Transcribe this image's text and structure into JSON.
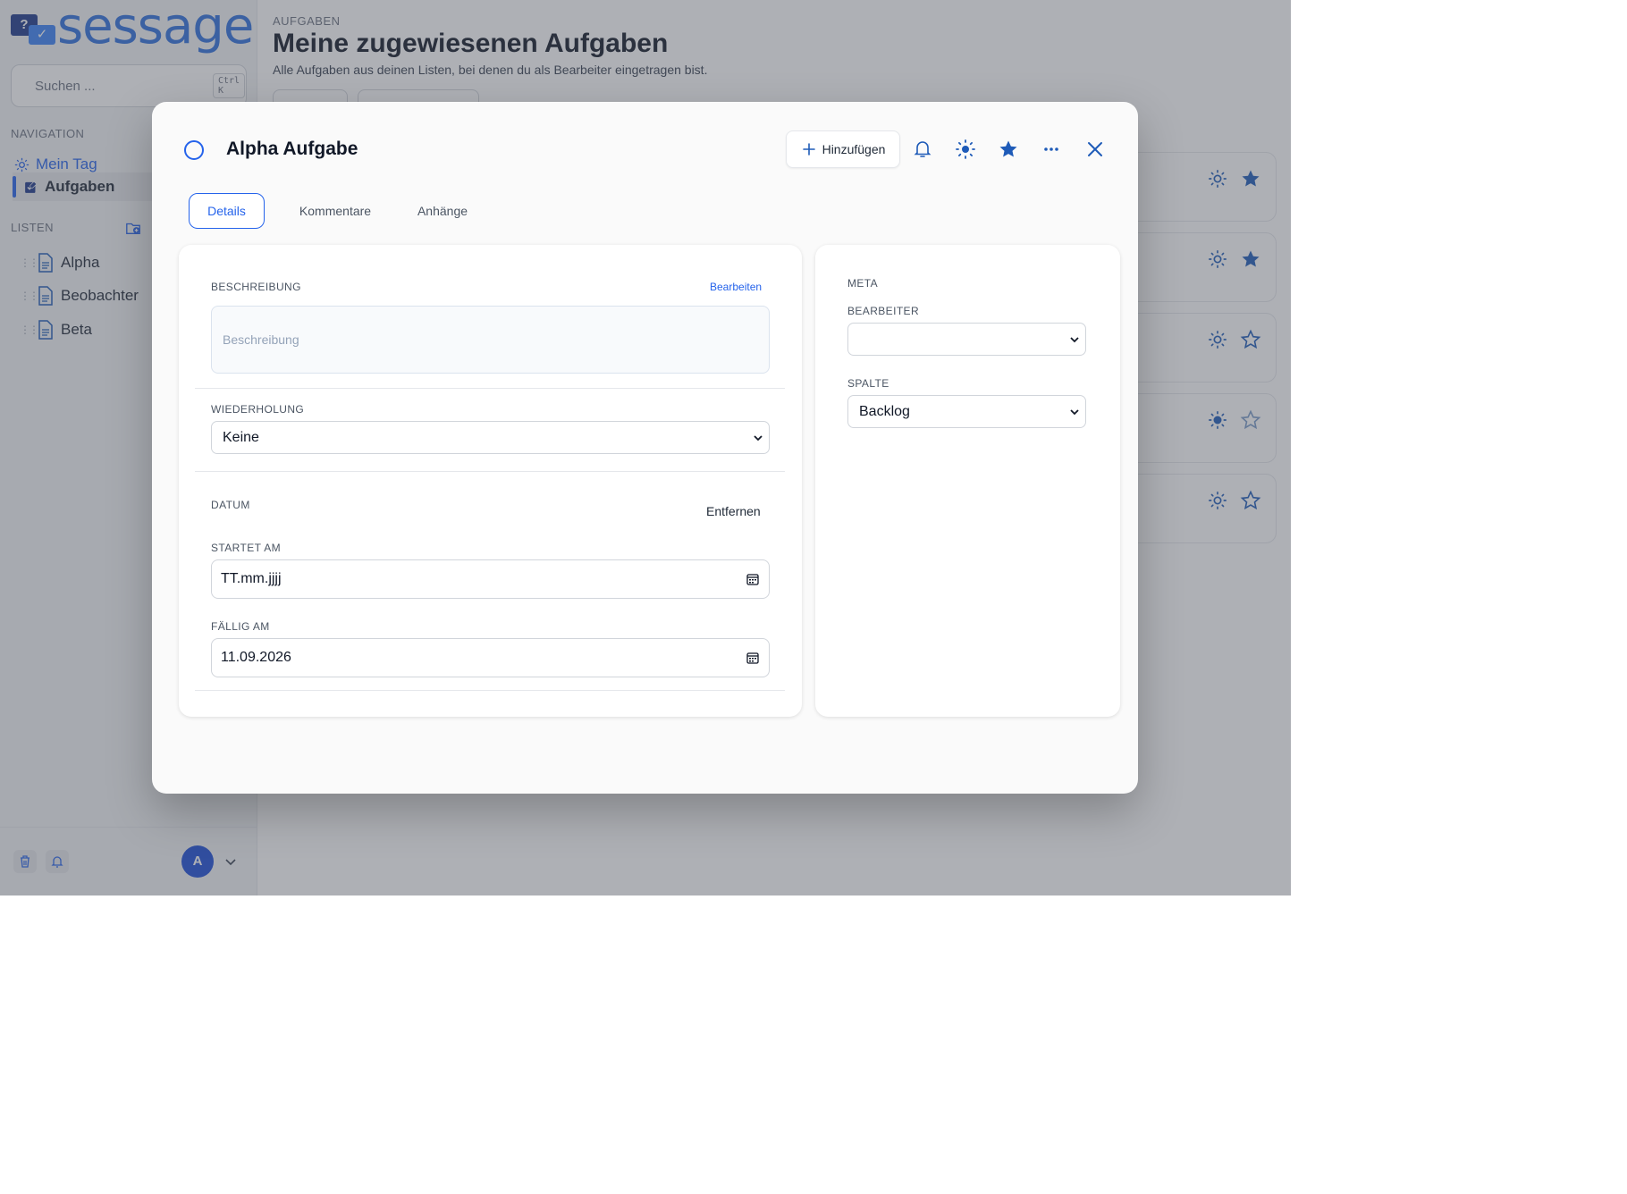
{
  "sidebar": {
    "logo_mark": "?",
    "logo_word": "sessage",
    "search": {
      "placeholder": "Suchen ...",
      "shortcut": "Ctrl K"
    },
    "navigation_label": "NAVIGATION",
    "nav_items": [
      {
        "label": "Mein Tag",
        "icon": "sun-icon"
      },
      {
        "label": "Aufgaben",
        "icon": "tasks-icon",
        "active": true
      }
    ],
    "lists_label": "LISTEN",
    "lists": [
      {
        "label": "Alpha",
        "icon": "document-icon"
      },
      {
        "label": "Beobachter",
        "icon": "document-icon"
      },
      {
        "label": "Beta",
        "icon": "document-icon"
      }
    ],
    "avatar_initial": "A"
  },
  "main": {
    "eyebrow": "AUFGABEN",
    "title": "Meine zugewiesenen Aufgaben",
    "subtitle": "Alle Aufgaben aus deinen Listen, bei denen du als Bearbeiter eingetragen bist.",
    "tasks": [
      {
        "in_my_day": true,
        "starred": true
      },
      {
        "in_my_day": true,
        "starred": true
      },
      {
        "in_my_day": true,
        "starred": false
      },
      {
        "in_my_day": true,
        "starred": false
      },
      {
        "in_my_day": true,
        "starred": false
      }
    ]
  },
  "modal": {
    "title": "Alpha Aufgabe",
    "add_label": "Hinzufügen",
    "starred": true,
    "tabs": [
      {
        "label": "Details",
        "active": true
      },
      {
        "label": "Kommentare"
      },
      {
        "label": "Anhänge"
      }
    ],
    "details": {
      "description_label": "BESCHREIBUNG",
      "edit_label": "Bearbeiten",
      "description_placeholder": "Beschreibung",
      "repeat_label": "WIEDERHOLUNG",
      "repeat_value": "Keine",
      "date_label": "DATUM",
      "remove_label": "Entfernen",
      "start_label": "STARTET AM",
      "start_value": "TT.mm.jjjj",
      "due_label": "FÄLLIG AM",
      "due_value": "11.09.2026"
    },
    "meta": {
      "heading": "META",
      "assignee_label": "BEARBEITER",
      "assignee_value": "",
      "column_label": "SPALTE",
      "column_value": "Backlog"
    }
  },
  "colors": {
    "accent": "#2563eb",
    "star_fill": "#1e5bb8",
    "overlay": "rgba(75,80,90,0.45)"
  }
}
